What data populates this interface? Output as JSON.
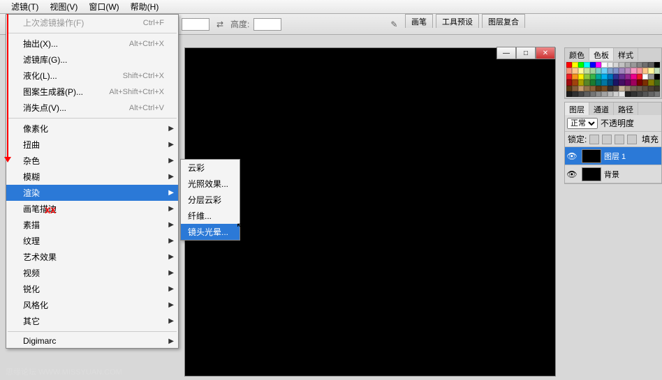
{
  "menubar": {
    "filter": "滤镜(T)",
    "view": "视图(V)",
    "window": "窗口(W)",
    "help": "帮助(H)"
  },
  "toolbar": {
    "swap_icon": "⇄",
    "height_label": "高度:",
    "brush_icon": "✎"
  },
  "tabs": {
    "brush": "画笔",
    "tool_preset": "工具预设",
    "layer_comp": "图层复合"
  },
  "filter_menu": {
    "last": {
      "label": "上次滤镜操作(F)",
      "sc": "Ctrl+F"
    },
    "extract": {
      "label": "抽出(X)...",
      "sc": "Alt+Ctrl+X"
    },
    "gallery": {
      "label": "滤镜库(G)..."
    },
    "liquify": {
      "label": "液化(L)...",
      "sc": "Shift+Ctrl+X"
    },
    "pattern": {
      "label": "图案生成器(P)...",
      "sc": "Alt+Shift+Ctrl+X"
    },
    "vanish": {
      "label": "消失点(V)...",
      "sc": "Alt+Ctrl+V"
    },
    "pixelate": "像素化",
    "distort": "扭曲",
    "noise": "杂色",
    "blur": "模糊",
    "render": "渲染",
    "brush_strokes": "画笔描边",
    "sketch": "素描",
    "texture": "纹理",
    "artistic": "艺术效果",
    "video": "视频",
    "sharpen": "锐化",
    "stylize": "风格化",
    "other": "其它",
    "digimarc": "Digimarc"
  },
  "render_sub": {
    "clouds": "云彩",
    "lighting": "光照效果...",
    "diff_clouds": "分层云彩",
    "fibers": "纤维...",
    "lens_flare": "镜头光晕..."
  },
  "swatch_tabs": {
    "color": "颜色",
    "swatches": "色板",
    "styles": "样式"
  },
  "swatch_colors": [
    "#ff0000",
    "#ffff00",
    "#00ff00",
    "#00ffff",
    "#0000ff",
    "#ff00ff",
    "#ffffff",
    "#ebebeb",
    "#d6d6d6",
    "#c2c2c2",
    "#adadad",
    "#999999",
    "#858585",
    "#707070",
    "#5c5c5c",
    "#000000",
    "#f7977a",
    "#fdc68c",
    "#fff79a",
    "#c4df9b",
    "#a3d39c",
    "#7accc8",
    "#6dcff6",
    "#7ea1cc",
    "#8293ca",
    "#a186be",
    "#bc8cbf",
    "#f49ac1",
    "#f5989d",
    "#fdc689",
    "#fff799",
    "#c2e0ba",
    "#ec1c24",
    "#f7941d",
    "#fff200",
    "#8cc63f",
    "#39b54a",
    "#00a99d",
    "#00aeef",
    "#0072bc",
    "#2e3192",
    "#662d91",
    "#92278f",
    "#ec008c",
    "#ed1c24",
    "#ffffff",
    "#959595",
    "#000000",
    "#9e0b0f",
    "#a0410d",
    "#aba000",
    "#598527",
    "#1a7b30",
    "#00746b",
    "#0076a3",
    "#004b80",
    "#1b1464",
    "#440e62",
    "#630460",
    "#9e005d",
    "#790000",
    "#7b2e00",
    "#827b00",
    "#406618",
    "#5b3a13",
    "#865d3a",
    "#c69c6d",
    "#94744a",
    "#8c6239",
    "#603913",
    "#754c24",
    "#362f2d",
    "#534741",
    "#c7b299",
    "#998675",
    "#736357",
    "#6a5d4d",
    "#5e4f3f",
    "#4b3f33",
    "#3c3629",
    "#1b1b1b",
    "#303030",
    "#474747",
    "#5e5e5e",
    "#757575",
    "#8c8c8c",
    "#a3a3a3",
    "#bababa",
    "#d1d1d1",
    "#e8e8e8",
    "#222222",
    "#333333",
    "#444444",
    "#555555",
    "#666666",
    "#777777"
  ],
  "layer_tabs": {
    "layers": "图层",
    "channels": "通道",
    "paths": "路径"
  },
  "layer_panel": {
    "blend": "正常",
    "opacity_label": "不透明度",
    "lock_label": "锁定:",
    "fill_label": "填充",
    "layer1": "图层 1",
    "background": "背景"
  },
  "red_xx": "XX",
  "watermark": "思缘论坛 WWW.MISSYUAN.COM"
}
